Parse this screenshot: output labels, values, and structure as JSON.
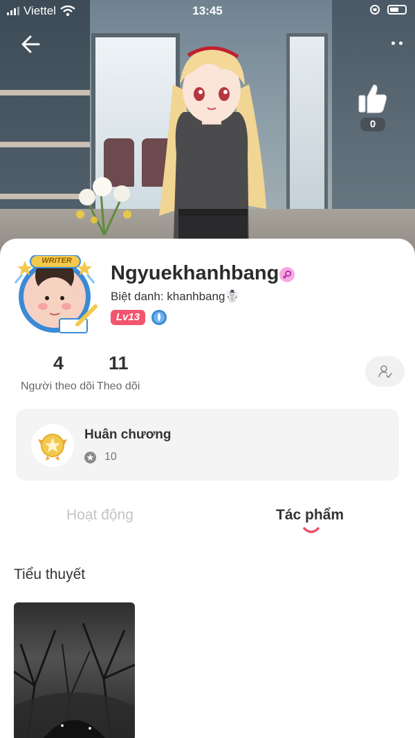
{
  "status_bar": {
    "carrier": "Viettel",
    "time": "13:45"
  },
  "hero": {
    "like_count": "0"
  },
  "profile": {
    "username": "Ngyuekhanhbang",
    "nickname": "Biệt danh: khanhbang☃️",
    "level": "Lv13",
    "avatar_badge": "WRITER"
  },
  "stats": {
    "followers_count": "4",
    "followers_label": "Người theo dõi",
    "following_count": "11",
    "following_label": "Theo dõi"
  },
  "medals": {
    "title": "Huân chương",
    "count": "10"
  },
  "tabs": [
    {
      "label": "Hoạt động",
      "active": false
    },
    {
      "label": "Tác phẩm",
      "active": true
    }
  ],
  "works": {
    "section_title": "Tiểu thuyết"
  },
  "colors": {
    "accent_pink": "#f2566f",
    "tab_indicator": "#ef4f6a",
    "medal_gold": "#f2c94c",
    "avatar_ring": "#3b8ad6"
  },
  "icons": [
    "back-arrow-icon",
    "more-icon",
    "thumbs-up-icon",
    "gender-icon",
    "shield-icon",
    "follow-user-icon",
    "medal-icon",
    "star-icon",
    "wifi-icon",
    "battery-icon"
  ]
}
